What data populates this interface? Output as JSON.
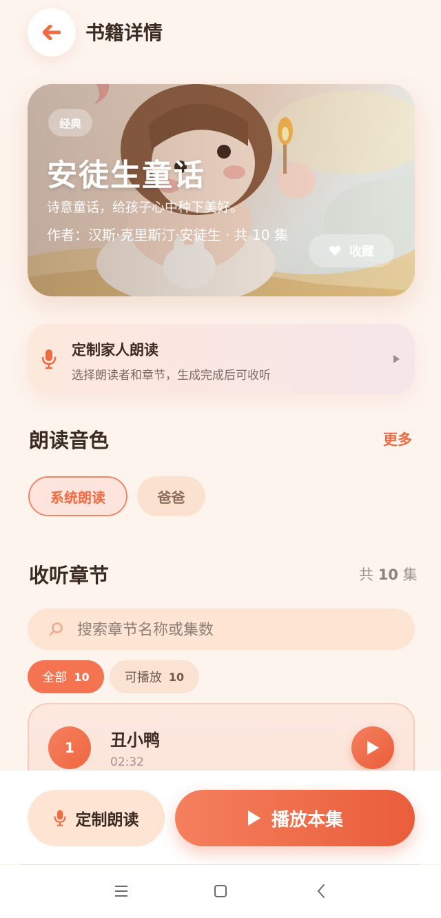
{
  "header": {
    "title": "书籍详情",
    "back_icon": "arrow-left-icon"
  },
  "book": {
    "tag": "经典",
    "title": "安徒生童话",
    "subtitle": "诗意童话，给孩子心中种下美好。",
    "author_line": "作者：汉斯·克里斯汀·安徒生 · 共 10 集",
    "favorite_label": "收藏",
    "favorite_icon": "heart-icon"
  },
  "family_reading": {
    "title": "定制家人朗读",
    "description": "选择朗读者和章节，生成完成后可收听",
    "icon": "microphone-icon"
  },
  "voices": {
    "title": "朗读音色",
    "more_label": "更多",
    "options": [
      {
        "label": "系统朗读",
        "selected": true
      },
      {
        "label": "爸爸",
        "selected": false
      }
    ]
  },
  "chapters": {
    "title": "收听章节",
    "count_prefix": "共",
    "count": "10",
    "count_suffix": "集",
    "search_placeholder": "搜索章节名称或集数",
    "filters": [
      {
        "label": "全部",
        "count": "10",
        "active": true
      },
      {
        "label": "可播放",
        "count": "10",
        "active": false
      }
    ],
    "episodes": [
      {
        "number": "1",
        "title": "丑小鸭",
        "duration": "02:32"
      }
    ]
  },
  "bottom_actions": {
    "custom_read_label": "定制朗读",
    "play_label": "播放本集"
  },
  "colors": {
    "accent": "#f06a42",
    "background": "#fdf4ee",
    "chip_bg": "#fbe1cf"
  }
}
